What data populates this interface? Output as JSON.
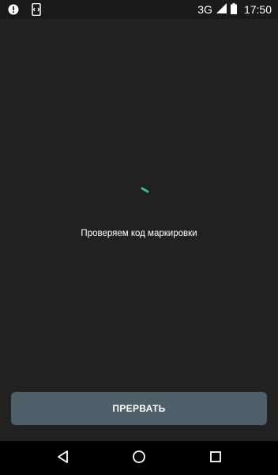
{
  "status_bar": {
    "network_type": "3G",
    "time": "17:50",
    "left_icons": [
      "alert-circle-icon",
      "phone-sync-icon"
    ]
  },
  "main": {
    "status_text": "Проверяем код маркировки",
    "spinner_color": "#2ec28c"
  },
  "actions": {
    "abort_label": "ПРЕРВАТЬ"
  },
  "navigation": {
    "buttons": [
      "back-icon",
      "home-icon",
      "recents-icon"
    ]
  },
  "colors": {
    "background": "#212121",
    "button": "#4f5f6a",
    "nav_bar": "#000000",
    "accent": "#2ec28c"
  }
}
